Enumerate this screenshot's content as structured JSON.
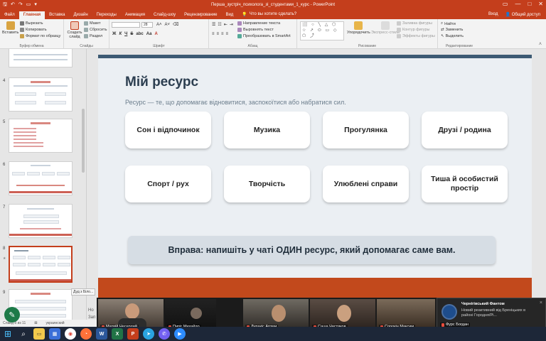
{
  "window": {
    "title": "Перша_зустріч_психолога_зі_студентами_1_курс - PowerPoint",
    "min_icon": "minimize-icon",
    "max_icon": "maximize-icon",
    "close_icon": "close-icon"
  },
  "quick_access": {
    "save": "🖫",
    "undo": "↶",
    "redo": "↷",
    "present": "▭",
    "more": "▾"
  },
  "tabs": [
    {
      "label": "Файл"
    },
    {
      "label": "Главная"
    },
    {
      "label": "Вставка"
    },
    {
      "label": "Дизайн"
    },
    {
      "label": "Переходы"
    },
    {
      "label": "Анимация"
    },
    {
      "label": "Слайд-шоу"
    },
    {
      "label": "Рецензирование"
    },
    {
      "label": "Вид"
    }
  ],
  "search_placeholder": "Что вы хотите сделать?",
  "signin": "Вход",
  "share": "Общий доступ",
  "ribbon": {
    "clipboard": {
      "paste": "Вставить",
      "cut": "Вырезать",
      "copy": "Копировать",
      "format": "Формат по образцу",
      "group": "Буфер обмена"
    },
    "slides": {
      "new": "Создать слайд",
      "layout": "Макет",
      "reset": "Сбросить",
      "section": "Раздел",
      "group": "Слайды"
    },
    "font": {
      "size": "28",
      "bold": "Ж",
      "italic": "К",
      "underline": "Ч",
      "strike": "S",
      "spacing": "abc",
      "case": "Аа",
      "group": "Шрифт"
    },
    "paragraph": {
      "direction": "Направление текста",
      "align": "Выровнять текст",
      "smartart": "Преобразовать в SmartArt",
      "group": "Абзац"
    },
    "drawing": {
      "shapes": "⬜ ○ ╲ △ ⬡ ☆ ↗ ⬭ ▭ ◇ ⬠ ⤴",
      "arrange": "Упорядочить",
      "quick_styles": "Экспресс-стили",
      "fill": "Заливка фигуры",
      "outline": "Контур фигуры",
      "effects": "Эффекты фигуры",
      "group": "Рисование"
    },
    "editing": {
      "find": "Найти",
      "replace": "Заменить",
      "select": "Выделить",
      "group": "Редактирование"
    }
  },
  "thumbnails": [
    {
      "num": "4"
    },
    {
      "num": "5"
    },
    {
      "num": "6"
    },
    {
      "num": "7"
    },
    {
      "num": "8"
    },
    {
      "num": "9"
    }
  ],
  "slide": {
    "title": "Мій ресурс",
    "subtitle": "Ресурс — те, що допомагає відновитися, заспокоїтися або набратися сил.",
    "cards": [
      "Сон і відпочинок",
      "Музика",
      "Прогулянка",
      "Друзі / родина",
      "Спорт / рух",
      "Творчість",
      "Улюблені справи",
      "Тиша й особистий простір"
    ],
    "exercise": "Вправа: напишіть у чаті ОДИН ресурс, який допомагає саме вам."
  },
  "notes_fragment": [
    "Но",
    "Зап"
  ],
  "tooltip": "Дуд з Біло...",
  "status": {
    "slide": "Слайд 8 из 11",
    "lang": "украинский"
  },
  "participants": [
    {
      "name": "Матвій Несерлий"
    },
    {
      "name": "Пиріг Михайло"
    },
    {
      "name": "Лупакіс Артем"
    },
    {
      "name": "Саша Чистяков"
    },
    {
      "name": "Сорокін Максим"
    },
    {
      "name": "Фурс Богдан"
    }
  ],
  "notification": {
    "sender": "Чернігівський Фантом",
    "text": "Новий реактивний від Бреніцьких в районі Городня/Рі...",
    "close": "×"
  },
  "taskbar": {
    "start": "⊞",
    "search": "⌕",
    "apps": [
      "files",
      "store",
      "chrome",
      "firefox",
      "word",
      "excel",
      "powerpoint",
      "telegram",
      "viber",
      "zoom"
    ]
  }
}
